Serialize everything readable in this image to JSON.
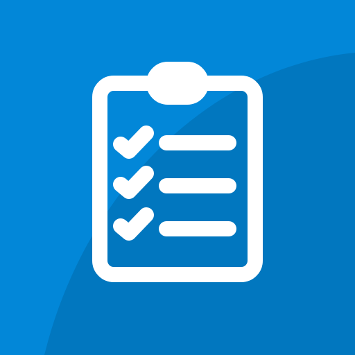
{
  "icon": {
    "name": "clipboard-checklist-icon",
    "checklist_items": 3,
    "colors": {
      "background": "#0287d8",
      "background_shadow": "#0177bf",
      "foreground": "#ffffff"
    }
  }
}
